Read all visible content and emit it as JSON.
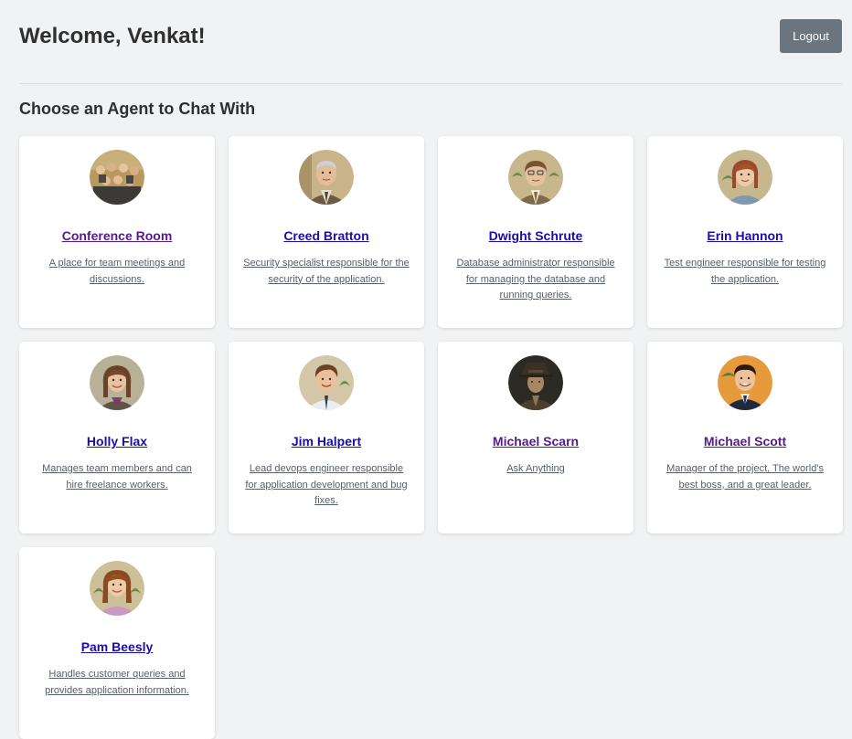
{
  "header": {
    "welcome": "Welcome, Venkat!",
    "logout_label": "Logout"
  },
  "section_title": "Choose an Agent to Chat With",
  "colors": {
    "background": "#f1f2f3",
    "link": "#1a0dab",
    "visited_link": "#551a8b",
    "logout_button": "#6b757d"
  },
  "agents": [
    {
      "name": "Conference Room",
      "description": "A place for team meetings and discussions.",
      "visited": true,
      "avatar": "group-portrait-icon"
    },
    {
      "name": "Creed Bratton",
      "description": "Security specialist responsible for the security of the application.",
      "visited": false,
      "avatar": "bald-man-portrait-icon"
    },
    {
      "name": "Dwight Schrute",
      "description": "Database administrator responsible for managing the database and running queries.",
      "visited": false,
      "avatar": "glasses-man-portrait-icon"
    },
    {
      "name": "Erin Hannon",
      "description": "Test engineer responsible for testing the application.",
      "visited": false,
      "avatar": "redhead-woman-portrait-icon"
    },
    {
      "name": "Holly Flax",
      "description": "Manages team members and can hire freelance workers.",
      "visited": false,
      "avatar": "brunette-woman-portrait-icon"
    },
    {
      "name": "Jim Halpert",
      "description": "Lead devops engineer responsible for application development and bug fixes.",
      "visited": false,
      "avatar": "man-tie-portrait-icon"
    },
    {
      "name": "Michael Scarn",
      "description": "Ask Anything",
      "visited": true,
      "avatar": "detective-hat-portrait-icon"
    },
    {
      "name": "Michael Scott",
      "description": "Manager of the project, The world's best boss, and a great leader.",
      "visited": true,
      "avatar": "man-suit-portrait-icon"
    },
    {
      "name": "Pam Beesly",
      "description": "Handles customer queries and provides application information.",
      "visited": false,
      "avatar": "woman-pink-portrait-icon"
    }
  ]
}
